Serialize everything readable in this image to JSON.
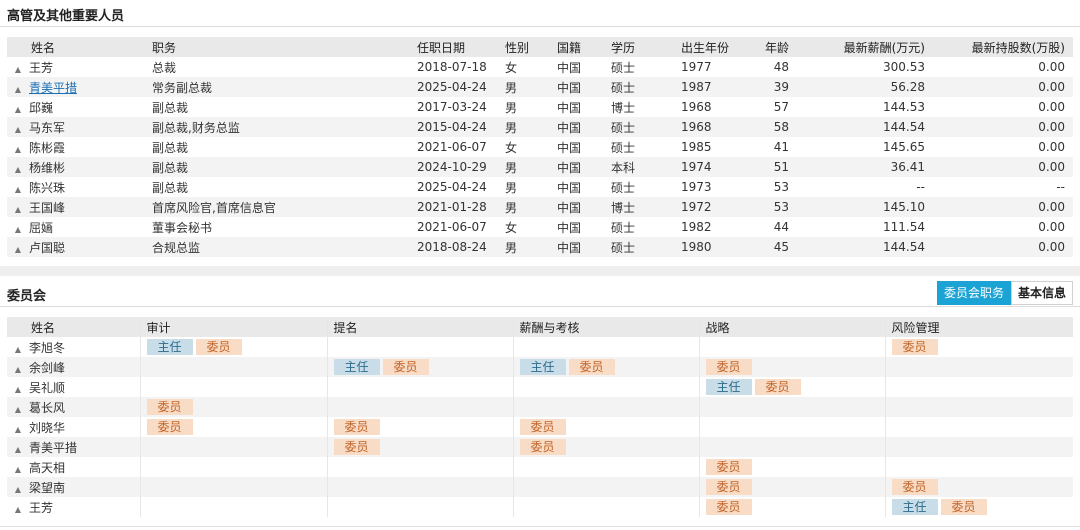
{
  "executives": {
    "title": "高管及其他重要人员",
    "columns": [
      "姓名",
      "职务",
      "任职日期",
      "性别",
      "国籍",
      "学历",
      "出生年份",
      "年龄",
      "最新薪酬(万元)",
      "最新持股数(万股)"
    ],
    "rows": [
      {
        "name": "王芳",
        "position": "总裁",
        "date": "2018-07-18",
        "gender": "女",
        "nationality": "中国",
        "education": "硕士",
        "birth": "1977",
        "age": "48",
        "salary": "300.53",
        "shares": "0.00",
        "link": false
      },
      {
        "name": "青美平措",
        "position": "常务副总裁",
        "date": "2025-04-24",
        "gender": "男",
        "nationality": "中国",
        "education": "硕士",
        "birth": "1987",
        "age": "39",
        "salary": "56.28",
        "shares": "0.00",
        "link": true
      },
      {
        "name": "邱巍",
        "position": "副总裁",
        "date": "2017-03-24",
        "gender": "男",
        "nationality": "中国",
        "education": "博士",
        "birth": "1968",
        "age": "57",
        "salary": "144.53",
        "shares": "0.00",
        "link": false
      },
      {
        "name": "马东军",
        "position": "副总裁,财务总监",
        "date": "2015-04-24",
        "gender": "男",
        "nationality": "中国",
        "education": "硕士",
        "birth": "1968",
        "age": "58",
        "salary": "144.54",
        "shares": "0.00",
        "link": false
      },
      {
        "name": "陈彬霞",
        "position": "副总裁",
        "date": "2021-06-07",
        "gender": "女",
        "nationality": "中国",
        "education": "硕士",
        "birth": "1985",
        "age": "41",
        "salary": "145.65",
        "shares": "0.00",
        "link": false
      },
      {
        "name": "杨维彬",
        "position": "副总裁",
        "date": "2024-10-29",
        "gender": "男",
        "nationality": "中国",
        "education": "本科",
        "birth": "1974",
        "age": "51",
        "salary": "36.41",
        "shares": "0.00",
        "link": false
      },
      {
        "name": "陈兴珠",
        "position": "副总裁",
        "date": "2025-04-24",
        "gender": "男",
        "nationality": "中国",
        "education": "硕士",
        "birth": "1973",
        "age": "53",
        "salary": "--",
        "shares": "--",
        "link": false
      },
      {
        "name": "王国峰",
        "position": "首席风险官,首席信息官",
        "date": "2021-01-28",
        "gender": "男",
        "nationality": "中国",
        "education": "博士",
        "birth": "1972",
        "age": "53",
        "salary": "145.10",
        "shares": "0.00",
        "link": false
      },
      {
        "name": "屈婳",
        "position": "董事会秘书",
        "date": "2021-06-07",
        "gender": "女",
        "nationality": "中国",
        "education": "硕士",
        "birth": "1982",
        "age": "44",
        "salary": "111.54",
        "shares": "0.00",
        "link": false
      },
      {
        "name": "卢国聪",
        "position": "合规总监",
        "date": "2018-08-24",
        "gender": "男",
        "nationality": "中国",
        "education": "硕士",
        "birth": "1980",
        "age": "45",
        "salary": "144.54",
        "shares": "0.00",
        "link": false
      }
    ]
  },
  "committee": {
    "title": "委员会",
    "buttons": {
      "active": "委员会职务",
      "inactive": "基本信息"
    },
    "columns": [
      "姓名",
      "审计",
      "提名",
      "薪酬与考核",
      "战略",
      "风险管理"
    ],
    "role_labels": {
      "chair": "主任",
      "member": "委员"
    },
    "rows": [
      {
        "name": "李旭冬",
        "roles": [
          [
            "chair",
            "member"
          ],
          [],
          [],
          [],
          [
            "member"
          ]
        ]
      },
      {
        "name": "余剑峰",
        "roles": [
          [],
          [
            "chair",
            "member"
          ],
          [
            "chair",
            "member"
          ],
          [
            "member"
          ],
          []
        ]
      },
      {
        "name": "吴礼顺",
        "roles": [
          [],
          [],
          [],
          [
            "chair",
            "member"
          ],
          []
        ]
      },
      {
        "name": "葛长风",
        "roles": [
          [
            "member"
          ],
          [],
          [],
          [],
          []
        ]
      },
      {
        "name": "刘晓华",
        "roles": [
          [
            "member"
          ],
          [
            "member"
          ],
          [
            "member"
          ],
          [],
          []
        ]
      },
      {
        "name": "青美平措",
        "roles": [
          [],
          [
            "member"
          ],
          [
            "member"
          ],
          [],
          []
        ]
      },
      {
        "name": "高天相",
        "roles": [
          [],
          [],
          [],
          [
            "member"
          ],
          []
        ]
      },
      {
        "name": "梁望南",
        "roles": [
          [],
          [],
          [],
          [
            "member"
          ],
          [
            "member"
          ]
        ]
      },
      {
        "name": "王芳",
        "roles": [
          [],
          [],
          [],
          [
            "member"
          ],
          [
            "chair",
            "member"
          ]
        ]
      }
    ]
  },
  "colors": {
    "accent": "#1aa3d4",
    "chair_bg": "#c9dde8",
    "member_bg": "#f8dcc6",
    "link": "#1a6fb5"
  }
}
